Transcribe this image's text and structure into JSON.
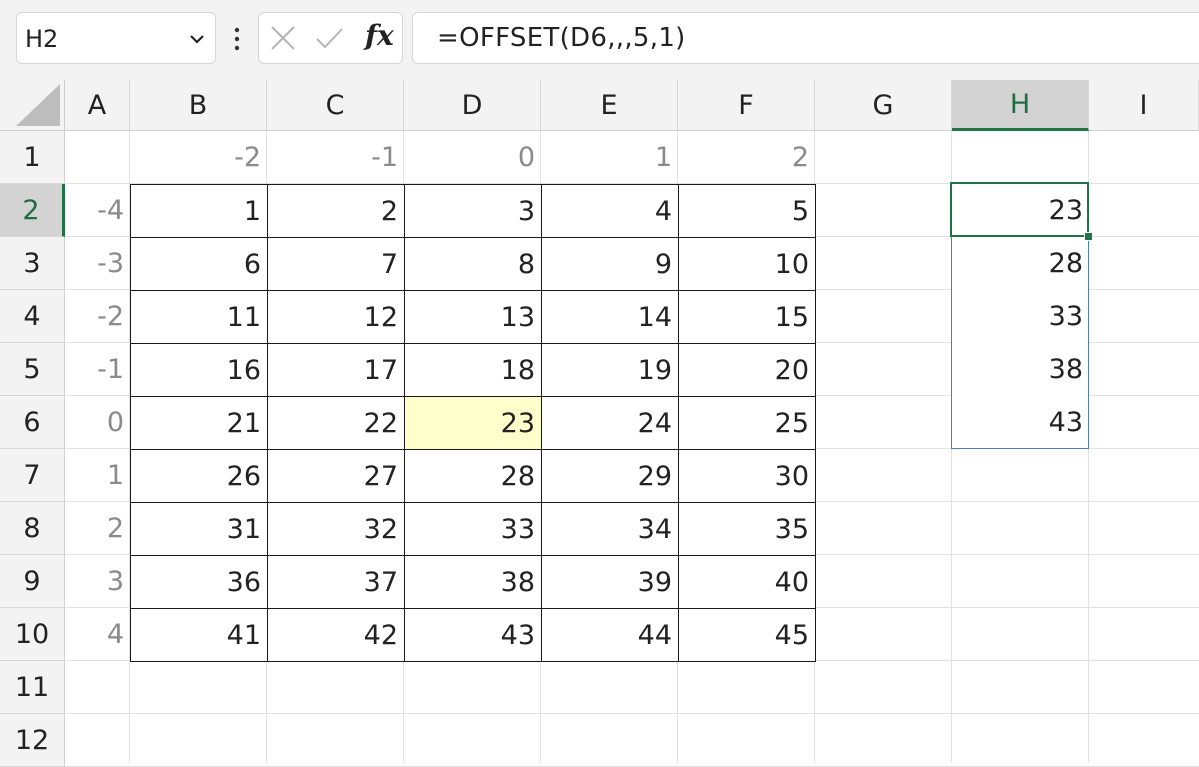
{
  "name_box": {
    "value": "H2"
  },
  "formula_bar": {
    "formula": "=OFFSET(D6,,,5,1)",
    "fx_label": "fx"
  },
  "columns": [
    "A",
    "B",
    "C",
    "D",
    "E",
    "F",
    "G",
    "H",
    "I"
  ],
  "rows": [
    "1",
    "2",
    "3",
    "4",
    "5",
    "6",
    "7",
    "8",
    "9",
    "10",
    "11",
    "12"
  ],
  "selected": {
    "column": "H",
    "row": "2"
  },
  "col_offsets": [
    "-2",
    "-1",
    "0",
    "1",
    "2"
  ],
  "row_offsets": [
    "-4",
    "-3",
    "-2",
    "-1",
    "0",
    "1",
    "2",
    "3",
    "4"
  ],
  "table": [
    [
      "1",
      "2",
      "3",
      "4",
      "5"
    ],
    [
      "6",
      "7",
      "8",
      "9",
      "10"
    ],
    [
      "11",
      "12",
      "13",
      "14",
      "15"
    ],
    [
      "16",
      "17",
      "18",
      "19",
      "20"
    ],
    [
      "21",
      "22",
      "23",
      "24",
      "25"
    ],
    [
      "26",
      "27",
      "28",
      "29",
      "30"
    ],
    [
      "31",
      "32",
      "33",
      "34",
      "35"
    ],
    [
      "36",
      "37",
      "38",
      "39",
      "40"
    ],
    [
      "41",
      "42",
      "43",
      "44",
      "45"
    ]
  ],
  "result": [
    "23",
    "28",
    "33",
    "38",
    "43"
  ],
  "colors": {
    "active_border": "#217346",
    "highlight": "#ffffcc",
    "spill_border": "#4a7fbf"
  }
}
